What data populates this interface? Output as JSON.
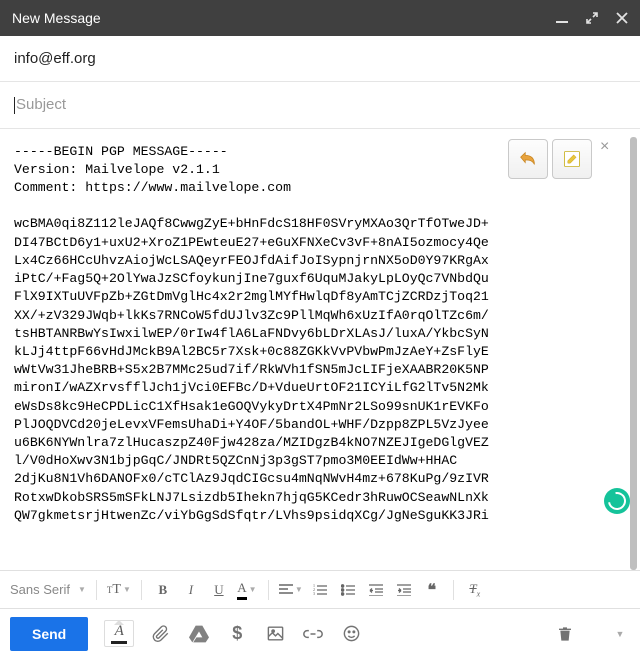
{
  "window": {
    "title": "New Message"
  },
  "fields": {
    "to": "info@eff.org",
    "subject_placeholder": "Subject"
  },
  "pgp": {
    "header": "-----BEGIN PGP MESSAGE-----",
    "version": "Version: Mailvelope v2.1.1",
    "comment": "Comment: https://www.mailvelope.com",
    "lines": [
      "wcBMA0qi8Z112leJAQf8CwwgZyE+bHnFdcS18HF0SVryMXAo3QrTfOTweJD+",
      "DI47BCtD6y1+uxU2+XroZ1PEwteuE27+eGuXFNXeCv3vF+8nAI5ozmocy4Qe",
      "Lx4Cz66HCcUhvzAiojWcLSAQeyrFEOJfdAifJoISypnjrnNX5oD0Y97KRgAx",
      "iPtC/+Fag5Q+2OlYwaJzSCfoykunjIne7guxf6UquMJakyLpLOyQc7VNbdQu",
      "FlX9IXTuUVFpZb+ZGtDmVglHc4x2r2mglMYfHwlqDf8yAmTCjZCRDzjToq21",
      "XX/+zV329JWqb+lkKs7RNCoW5fdUJlv3Zc9PllMqWh6xUzIfA0rqOlTZc6m/",
      "tsHBTANRBwYsIwxilwEP/0rIw4flA6LaFNDvy6bLDrXLAsJ/luxA/YkbcSyN",
      "kLJj4ttpF66vHdJMckB9Al2BC5r7Xsk+0c88ZGKkVvPVbwPmJzAeY+ZsFlyE",
      "wWtVw31JheBRB+S5x2B7MMc25ud7if/RkWVh1fSN5mJcLIFjeXAABR20K5NP",
      "mironI/wAZXrvsfflJch1jVci0EFBc/D+VdueUrtOF21ICYiLfG2lTv5N2Mk",
      "eWsDs8kc9HeCPDLicC1XfHsak1eGOQVykyDrtX4PmNr2LSo99snUK1rEVKFo",
      "PlJOQDVCd20jeLevxVFemsUhaDi+Y4OF/5bandOL+WHF/Dzpp8ZPL5VzJyee",
      "u6BK6NYWnlra7zlHucaszpZ40Fjw428za/MZIDgzB4kNO7NZEJIgeDGlgVEZ",
      "l/V0dHoXwv3N1bjpGqC/JNDRt5QZCnNj3p3gST7pmo3M0EEIdWw+HHAC",
      "2djKu8N1Vh6DANOFx0/cTClAz9JqdCIGcsu4mNqNWvH4mz+678KuPg/9zIVR",
      "RotxwDkobSRS5mSFkLNJ7Lsizdb5Ihekn7hjqG5KCedr3hRuwOCSeawNLnXk",
      "QW7gkmetsrjHtwenZc/viYbGgSdSfqtr/LVhs9psidqXCg/JgNeSguKK3JRi"
    ]
  },
  "format": {
    "font": "Sans Serif"
  },
  "actions": {
    "send": "Send"
  }
}
